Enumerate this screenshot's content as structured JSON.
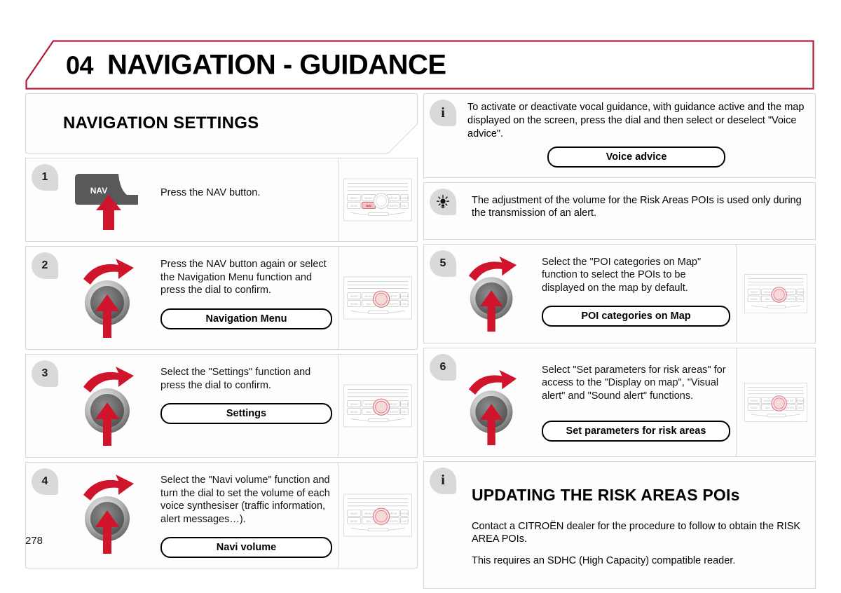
{
  "page": {
    "chapter_number": "04",
    "chapter_title": "NAVIGATION - GUIDANCE",
    "page_number": "278",
    "accent_color": "#b01c38",
    "badge_color": "#d9d9d9"
  },
  "left_column": {
    "section_title": "NAVIGATION SETTINGS",
    "steps": [
      {
        "number": "1",
        "graphic": "nav-button-press-icon",
        "text": "Press the NAV button.",
        "pill": null,
        "media": "radio-unit-nav-highlight"
      },
      {
        "number": "2",
        "graphic": "dial-turn-press-icon",
        "text": "Press the NAV button again or select the Navigation Menu function and press the dial to confirm.",
        "pill": "Navigation Menu",
        "media": "radio-unit-dial-highlight"
      },
      {
        "number": "3",
        "graphic": "dial-turn-press-icon",
        "text": "Select the \"Settings\" function and press the dial to confirm.",
        "pill": "Settings",
        "media": "radio-unit-dial-highlight"
      },
      {
        "number": "4",
        "graphic": "dial-turn-press-icon",
        "text": "Select the \"Navi volume\" function and turn the dial to set the volume of each voice synthesiser (traffic information, alert messages…).",
        "pill": "Navi volume",
        "media": "radio-unit-dial-highlight"
      }
    ]
  },
  "right_column": {
    "info_note": {
      "icon": "info-icon",
      "text": "To activate or deactivate vocal guidance, with guidance active and the map displayed on the screen, press the dial and then select or deselect \"Voice advice\".",
      "pill": "Voice advice"
    },
    "tip_note": {
      "icon": "tip-lamp-icon",
      "text": "The adjustment of the volume for the Risk Areas POIs is used only during the transmission of an alert."
    },
    "steps": [
      {
        "number": "5",
        "graphic": "dial-turn-press-icon",
        "text": "Select the \"POI categories on Map\" function to select the POIs to be displayed on the map by default.",
        "pill": "POI categories on Map",
        "media": "radio-unit-dial-highlight"
      },
      {
        "number": "6",
        "graphic": "dial-turn-press-icon",
        "text": "Select \"Set parameters for risk areas\" for access to the \"Display on map\", \"Visual alert\" and \"Sound alert\" functions.",
        "pill": "Set parameters for risk areas",
        "media": "radio-unit-dial-highlight"
      }
    ],
    "final_section": {
      "icon": "info-icon",
      "title": "UPDATING THE RISK AREAS POIs",
      "paragraph_1": "Contact a CITROËN dealer for the procedure to follow to obtain the RISK AREA POIs.",
      "paragraph_2": "This requires an SDHC (High Capacity) compatible reader."
    }
  },
  "radio_unit": {
    "buttons_row_1": [
      "RADIO",
      "MUSIC",
      "SETUP",
      "PHONE"
    ],
    "buttons_row_2": [
      "MODE",
      "NAV",
      "TRAFFIC",
      "ESC"
    ]
  }
}
